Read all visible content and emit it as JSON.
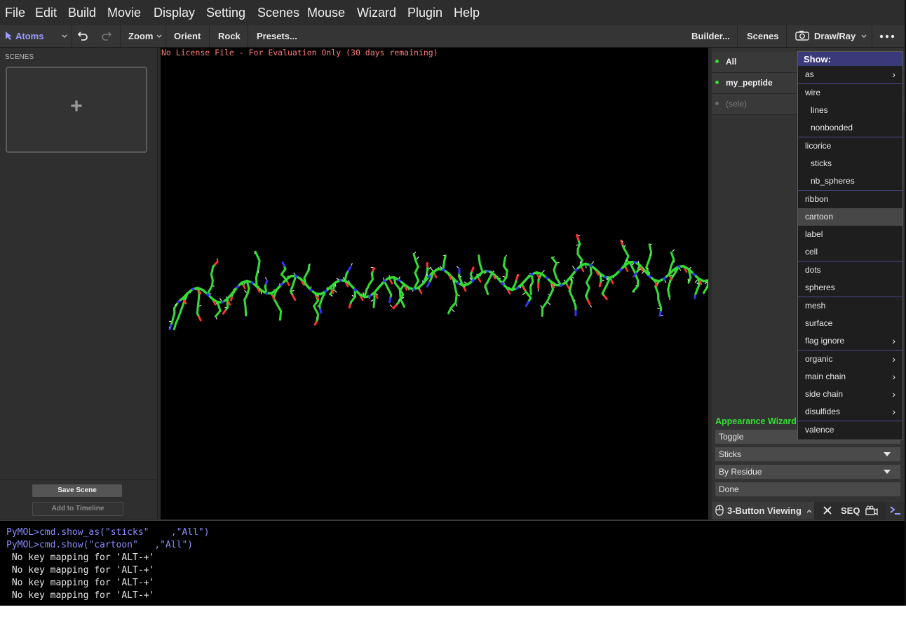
{
  "menu": [
    "File",
    "Edit",
    "Build",
    "Movie",
    "Display",
    "Setting",
    "Scenes",
    "Mouse",
    "Wizard",
    "Plugin",
    "Help"
  ],
  "toolbar": {
    "mode": "Atoms",
    "zoom": "Zoom",
    "orient": "Orient",
    "rock": "Rock",
    "presets": "Presets...",
    "builder": "Builder...",
    "scenes": "Scenes",
    "draw_ray": "Draw/Ray"
  },
  "scenes_panel": {
    "title": "SCENES",
    "add": "+",
    "save_scene": "Save Scene",
    "add_to_timeline": "Add to Timeline"
  },
  "viewport": {
    "license_text": "No License File - For Evaluation Only (30 days remaining)"
  },
  "objects": [
    {
      "name": "All",
      "dot_color": "#2ee02e",
      "text_color": "#f0f0f0"
    },
    {
      "name": "my_peptide",
      "dot_color": "#2ee02e",
      "text_color": "#f0f0f0"
    },
    {
      "name": "(sele)",
      "dot_color": "#6a6a6a",
      "text_color": "#7a7a7a"
    }
  ],
  "wizard": {
    "title": "Appearance Wizard",
    "toggle": "Toggle",
    "representation": "Sticks",
    "color_by": "By Residue",
    "done": "Done"
  },
  "bottom_bar": {
    "mouse_mode": "3-Button Viewing",
    "seq": "SEQ"
  },
  "show_menu": {
    "title": "Show:",
    "items": [
      {
        "label": "as",
        "indent": false,
        "arrow": true
      },
      {
        "label": "wire",
        "indent": false
      },
      {
        "label": "lines",
        "indent": true
      },
      {
        "label": "nonbonded",
        "indent": true
      },
      {
        "label": "licorice",
        "indent": false
      },
      {
        "label": "sticks",
        "indent": true
      },
      {
        "label": "nb_spheres",
        "indent": true
      },
      {
        "label": "ribbon",
        "indent": false
      },
      {
        "label": "cartoon",
        "indent": false,
        "highlight": true
      },
      {
        "label": "label",
        "indent": false
      },
      {
        "label": "cell",
        "indent": false
      },
      {
        "label": "dots",
        "indent": false
      },
      {
        "label": "spheres",
        "indent": false
      },
      {
        "label": "mesh",
        "indent": false
      },
      {
        "label": "surface",
        "indent": false
      },
      {
        "label": "flag ignore",
        "indent": false,
        "arrow": true
      },
      {
        "label": "organic",
        "indent": false,
        "arrow": true
      },
      {
        "label": "main chain",
        "indent": false,
        "arrow": true
      },
      {
        "label": "side chain",
        "indent": false,
        "arrow": true
      },
      {
        "label": "disulfides",
        "indent": false,
        "arrow": true
      },
      {
        "label": "valence",
        "indent": false
      }
    ]
  },
  "console": [
    {
      "text": "PyMOL>cmd.show_as(\"sticks\"    ,\"All\")",
      "color": "#8c8cff"
    },
    {
      "text": "PyMOL>cmd.show(\"cartoon\"   ,\"All\")",
      "color": "#8c8cff"
    },
    {
      "text": " No key mapping for 'ALT-+'",
      "color": "#e6e6e6"
    },
    {
      "text": " No key mapping for 'ALT-+'",
      "color": "#e6e6e6"
    },
    {
      "text": " No key mapping for 'ALT-+'",
      "color": "#e6e6e6"
    },
    {
      "text": " No key mapping for 'ALT-+'",
      "color": "#e6e6e6"
    }
  ],
  "colors": {
    "accent": "#8c8cff",
    "wizard_title": "#33e033",
    "menu_header": "#3a3a7a",
    "carbon": "#33dd33",
    "nitrogen": "#3333ff",
    "oxygen": "#ff3333",
    "hydrogen": "#e6e6e6"
  }
}
